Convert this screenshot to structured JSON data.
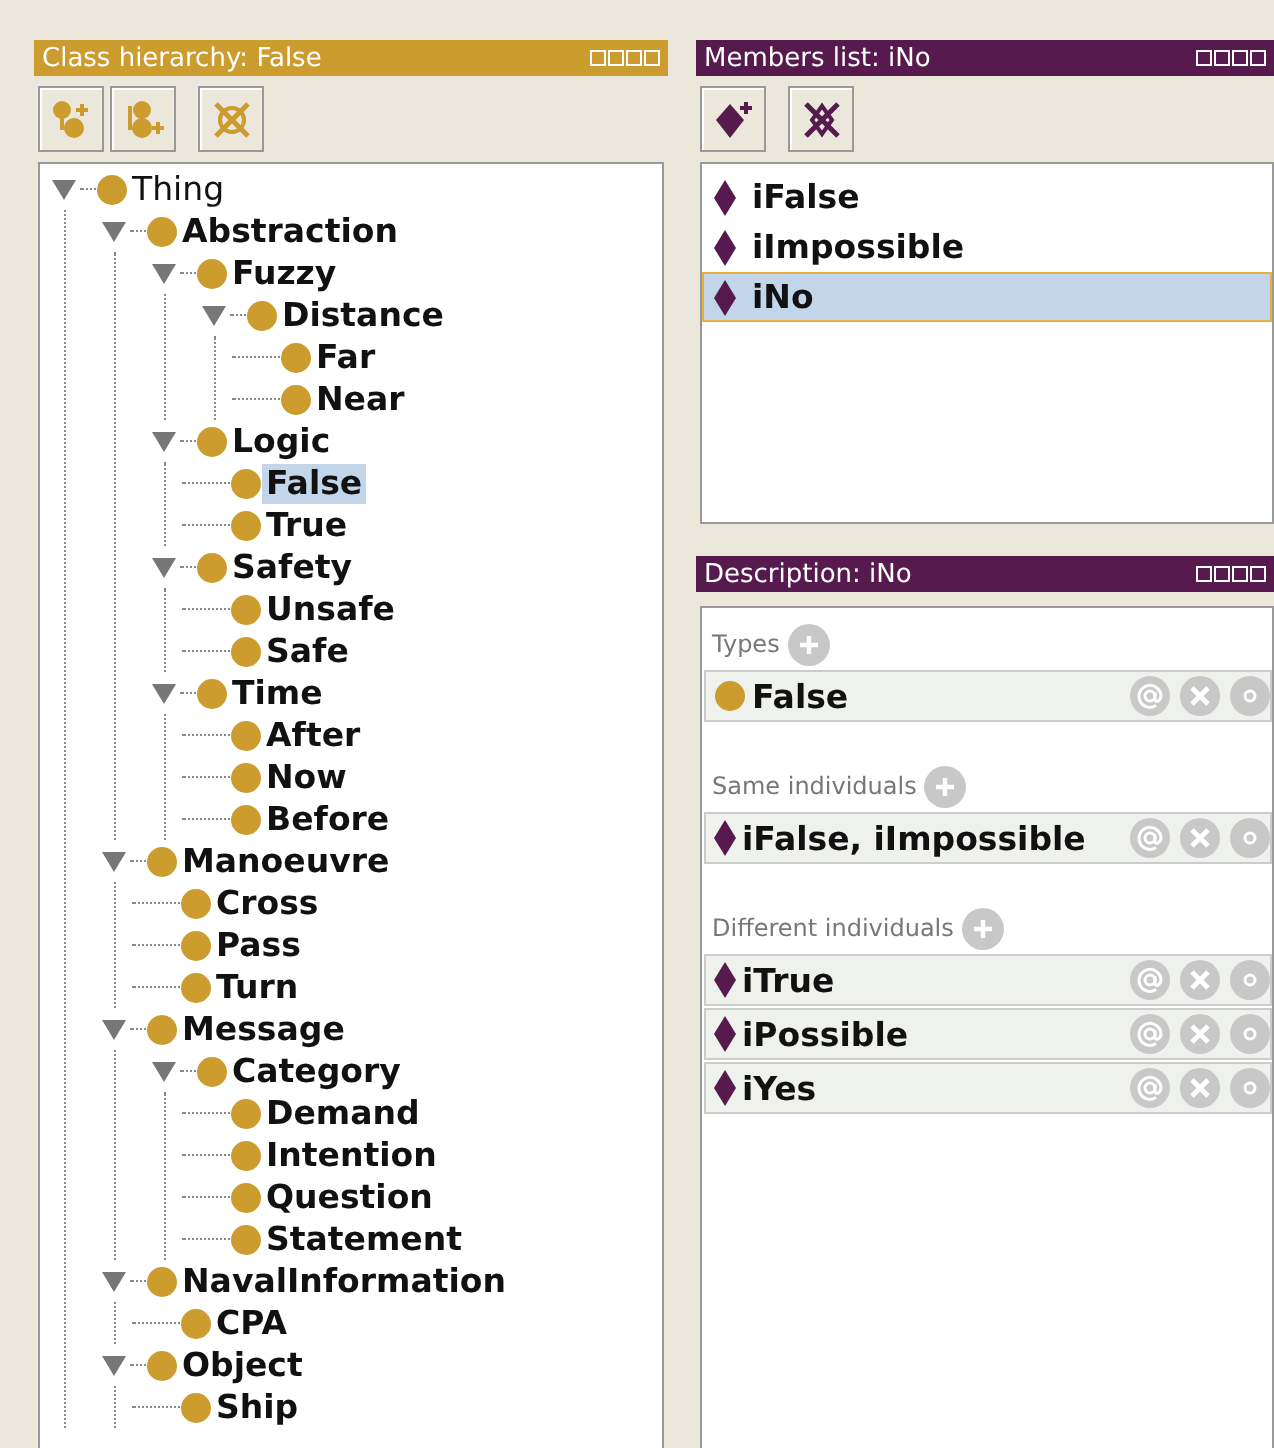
{
  "class_hierarchy": {
    "title": "Class hierarchy: False",
    "tree": [
      {
        "label": "Thing",
        "expanded": true,
        "selected": false,
        "children": [
          {
            "label": "Abstraction",
            "expanded": true,
            "selected": false,
            "children": [
              {
                "label": "Fuzzy",
                "expanded": true,
                "selected": false,
                "children": [
                  {
                    "label": "Distance",
                    "expanded": true,
                    "selected": false,
                    "children": [
                      {
                        "label": "Far",
                        "selected": false
                      },
                      {
                        "label": "Near",
                        "selected": false
                      }
                    ]
                  }
                ]
              },
              {
                "label": "Logic",
                "expanded": true,
                "selected": false,
                "children": [
                  {
                    "label": "False",
                    "selected": true
                  },
                  {
                    "label": "True",
                    "selected": false
                  }
                ]
              },
              {
                "label": "Safety",
                "expanded": true,
                "selected": false,
                "children": [
                  {
                    "label": "Unsafe",
                    "selected": false
                  },
                  {
                    "label": "Safe",
                    "selected": false
                  }
                ]
              },
              {
                "label": "Time",
                "expanded": true,
                "selected": false,
                "children": [
                  {
                    "label": "After",
                    "selected": false
                  },
                  {
                    "label": "Now",
                    "selected": false
                  },
                  {
                    "label": "Before",
                    "selected": false
                  }
                ]
              }
            ]
          },
          {
            "label": "Manoeuvre",
            "expanded": true,
            "selected": false,
            "children": [
              {
                "label": "Cross",
                "selected": false
              },
              {
                "label": "Pass",
                "selected": false
              },
              {
                "label": "Turn",
                "selected": false
              }
            ]
          },
          {
            "label": "Message",
            "expanded": true,
            "selected": false,
            "children": [
              {
                "label": "Category",
                "expanded": true,
                "selected": false,
                "children": [
                  {
                    "label": "Demand",
                    "selected": false
                  },
                  {
                    "label": "Intention",
                    "selected": false
                  },
                  {
                    "label": "Question",
                    "selected": false
                  },
                  {
                    "label": "Statement",
                    "selected": false
                  }
                ]
              }
            ]
          },
          {
            "label": "NavalInformation",
            "expanded": true,
            "selected": false,
            "children": [
              {
                "label": "CPA",
                "selected": false
              }
            ]
          },
          {
            "label": "Object",
            "expanded": true,
            "selected": false,
            "children": [
              {
                "label": "Ship",
                "selected": false
              }
            ]
          }
        ]
      }
    ]
  },
  "members_list": {
    "title": "Members list: iNo",
    "items": [
      {
        "label": "iFalse",
        "selected": false
      },
      {
        "label": "iImpossible",
        "selected": false
      },
      {
        "label": "iNo",
        "selected": true
      }
    ]
  },
  "description": {
    "title": "Description: iNo",
    "sections": [
      {
        "heading": "Types",
        "rows": [
          {
            "kind": "class",
            "label": "False"
          }
        ]
      },
      {
        "heading": "Same individuals",
        "rows": [
          {
            "kind": "individual",
            "label": "iFalse, iImpossible"
          }
        ]
      },
      {
        "heading": "Different individuals",
        "rows": [
          {
            "kind": "individual",
            "label": "iTrue"
          },
          {
            "kind": "individual",
            "label": "iPossible"
          },
          {
            "kind": "individual",
            "label": "iYes"
          }
        ]
      }
    ]
  }
}
